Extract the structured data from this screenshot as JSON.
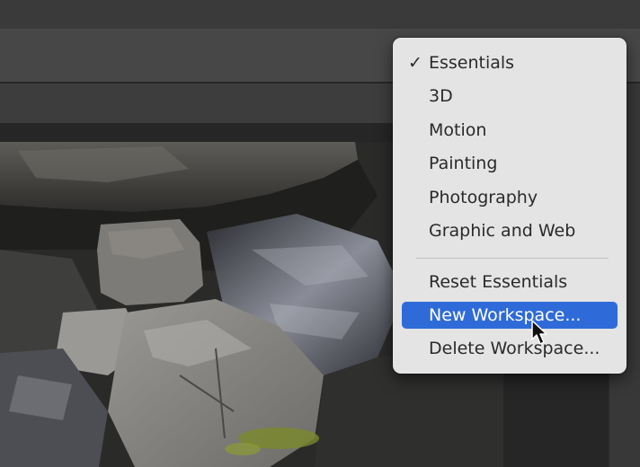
{
  "workspace_menu": {
    "items": [
      {
        "label": "Essentials",
        "checked": true
      },
      {
        "label": "3D"
      },
      {
        "label": "Motion"
      },
      {
        "label": "Painting"
      },
      {
        "label": "Photography"
      },
      {
        "label": "Graphic and Web"
      }
    ],
    "actions": [
      {
        "label": "Reset Essentials"
      },
      {
        "label": "New Workspace...",
        "highlighted": true
      },
      {
        "label": "Delete Workspace..."
      }
    ],
    "check_glyph": "✓",
    "highlight_color": "#2f6bd8"
  },
  "icons": {
    "checkmark": "checkmark-icon",
    "cursor": "pointer-cursor-icon"
  },
  "colors": {
    "menu_background": "#e4e4e4",
    "app_chrome": "#474747"
  }
}
